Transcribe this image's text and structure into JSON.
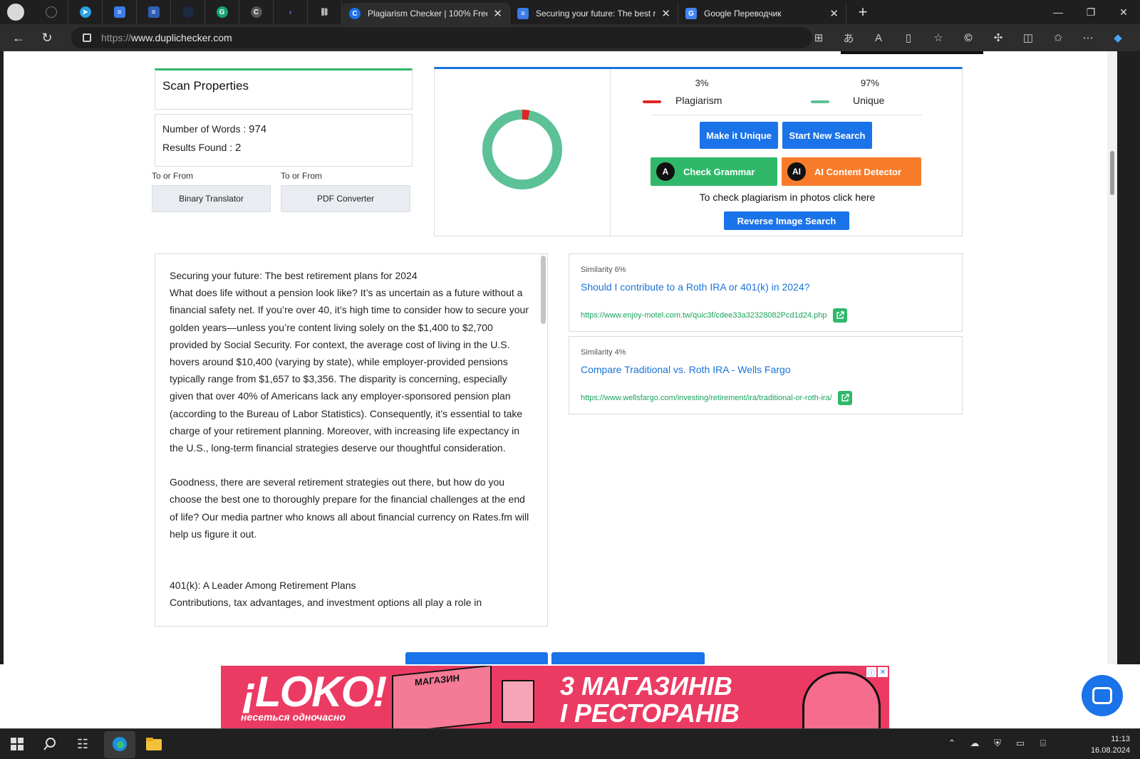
{
  "browser": {
    "tabs": [
      {
        "title": "Plagiarism Checker | 100% Free a",
        "active": true
      },
      {
        "title": "Securing your future: The best re",
        "active": false
      },
      {
        "title": "Google Переводчик",
        "active": false
      }
    ],
    "url_protocol": "https://",
    "url_host": "www.duplichecker.com"
  },
  "scan_properties": {
    "title": "Scan Properties",
    "words_label": "Number of Words :",
    "words_value": "974",
    "results_label": "Results Found :",
    "results_value": "2",
    "to_from_1": "To or From",
    "to_from_2": "To or From",
    "binary_btn": "Binary Translator",
    "pdf_btn": "PDF Converter"
  },
  "results": {
    "plagiarism_pct": "3%",
    "plagiarism_label": "Plagiarism",
    "unique_pct": "97%",
    "unique_label": "Unique",
    "plagiarism_fraction": 0.03,
    "colors": {
      "plagiarism": "#e02424",
      "unique": "#5cc196"
    },
    "make_unique_btn": "Make it Unique",
    "new_search_btn": "Start New Search",
    "grammar_btn": "Check Grammar",
    "ai_btn": "AI Content Detector",
    "photo_hint": "To check plagiarism in photos click here",
    "reverse_btn": "Reverse Image Search"
  },
  "document_text": {
    "p1": "Securing your future: The best retirement plans for 2024",
    "p2": "What does life without a pension look like? It’s as uncertain as a future without a financial safety net. If you’re over 40, it’s high time to consider how to secure your golden years—unless you’re content living solely on the $1,400 to $2,700 provided by Social Security. For context, the average cost of living in the U.S. hovers around $10,400 (varying by state), while employer-provided pensions typically range from $1,657 to $3,356. The disparity is concerning, especially given that over 40% of Americans lack any employer-sponsored pension plan (according to the Bureau of Labor Statistics). Consequently, it’s essential to take charge of your retirement planning. Moreover, with increasing life expectancy in the U.S., long-term financial strategies deserve our thoughtful consideration.",
    "p3": "Goodness, there are several retirement strategies out there, but how do you choose the best one to thoroughly prepare for the financial challenges at the end of life? Our media partner who knows all about financial currency on Rates.fm will help us figure it out.",
    "p4": "401(k): A Leader Among Retirement Plans",
    "p5": "Contributions, tax advantages, and investment options all play a role in"
  },
  "matches": [
    {
      "similarity": "Similarity 6%",
      "title": "Should I contribute to a Roth IRA or 401(k) in 2024?",
      "url": "https://www.enjoy-motel.com.tw/quic3f/cdee33a32328082Pcd1d24.php"
    },
    {
      "similarity": "Similarity 4%",
      "title": "Compare Traditional vs. Roth IRA - Wells Fargo",
      "url": "https://www.wellsfargo.com/investing/retirement/ira/traditional-or-roth-ira/"
    }
  ],
  "ad": {
    "brand": "¡LOKO!",
    "tagline": "несеться одночасно",
    "shop_sign": "МАГАЗИН",
    "headline_1": "3 МАГАЗИНІВ",
    "headline_2": "І РЕСТОРАНІВ"
  },
  "taskbar": {
    "time": "11:13",
    "date": "16.08.2024"
  }
}
